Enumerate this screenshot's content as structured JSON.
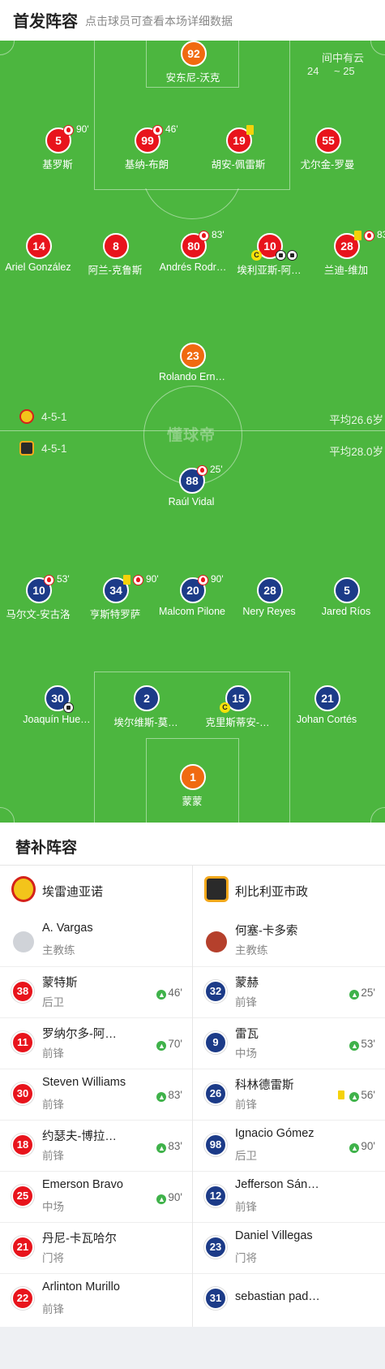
{
  "header": {
    "title": "首发阵容",
    "subtitle": "点击球员可查看本场详细数据"
  },
  "weather": {
    "condition": "间中有云",
    "temp_low": "24",
    "temp_high": "~ 25"
  },
  "watermark": "懂球帝",
  "home": {
    "formation": "4-5-1",
    "avg_age": "平均26.6岁",
    "players": [
      {
        "num": "92",
        "name": "安东尼-沃克",
        "color": "orange"
      },
      {
        "num": "5",
        "name": "基罗斯",
        "color": "red",
        "sub": "90'"
      },
      {
        "num": "99",
        "name": "基纳-布朗",
        "color": "red",
        "sub": "46'"
      },
      {
        "num": "19",
        "name": "胡安-佩雷斯",
        "color": "red"
      },
      {
        "num": "55",
        "name": "尤尔金-罗曼",
        "color": "red"
      },
      {
        "num": "14",
        "name": "Ariel González",
        "color": "red"
      },
      {
        "num": "8",
        "name": "阿兰-克鲁斯",
        "color": "red"
      },
      {
        "num": "80",
        "name": "Andrés Rodr…",
        "color": "red",
        "sub": "83'"
      },
      {
        "num": "10",
        "name": "埃利亚斯-阿…",
        "color": "red",
        "captain": "C"
      },
      {
        "num": "28",
        "name": "兰迪-维加",
        "color": "red",
        "sub": "83"
      },
      {
        "num": "23",
        "name": "Rolando Ern…",
        "color": "orange"
      }
    ]
  },
  "away": {
    "formation": "4-5-1",
    "avg_age": "平均28.0岁",
    "players": [
      {
        "num": "88",
        "name": "Raúl Vidal",
        "color": "blue",
        "sub": "25'"
      },
      {
        "num": "10",
        "name": "马尔文-安古洛",
        "color": "blue",
        "sub": "53'"
      },
      {
        "num": "34",
        "name": "亨斯特罗萨",
        "color": "blue",
        "sub": "90'"
      },
      {
        "num": "20",
        "name": "Malcom Pilone",
        "color": "blue",
        "sub": "90'"
      },
      {
        "num": "28",
        "name": "Nery Reyes",
        "color": "blue"
      },
      {
        "num": "5",
        "name": "Jared Ríos",
        "color": "blue"
      },
      {
        "num": "30",
        "name": "Joaquín Hue…",
        "color": "blue"
      },
      {
        "num": "2",
        "name": "埃尔维斯-莫…",
        "color": "blue"
      },
      {
        "num": "15",
        "name": "克里斯蒂安-…",
        "color": "blue",
        "captain": "C"
      },
      {
        "num": "21",
        "name": "Johan Cortés",
        "color": "blue"
      },
      {
        "num": "1",
        "name": "蒙蒙",
        "color": "orange"
      }
    ]
  },
  "bench": {
    "title": "替补阵容",
    "left": {
      "team": "埃雷迪亚诺",
      "coach": {
        "name": "A. Vargas",
        "role": "主教练"
      },
      "players": [
        {
          "num": "38",
          "name": "蒙特斯",
          "pos": "后卫",
          "sub": "46'"
        },
        {
          "num": "11",
          "name": "罗纳尔多-阿…",
          "pos": "前锋",
          "sub": "70'"
        },
        {
          "num": "30",
          "name": "Steven Williams",
          "pos": "前锋",
          "sub": "83'"
        },
        {
          "num": "18",
          "name": "约瑟夫-博拉…",
          "pos": "前锋",
          "sub": "83'"
        },
        {
          "num": "25",
          "name": "Emerson Bravo",
          "pos": "中场",
          "sub": "90'"
        },
        {
          "num": "21",
          "name": "丹尼-卡瓦哈尔",
          "pos": "门将",
          "sub": ""
        },
        {
          "num": "22",
          "name": "Arlinton Murillo",
          "pos": "前锋",
          "sub": ""
        }
      ]
    },
    "right": {
      "team": "利比利亚市政",
      "coach": {
        "name": "何塞-卡多索",
        "role": "主教练"
      },
      "players": [
        {
          "num": "32",
          "name": "蒙赫",
          "pos": "前锋",
          "sub": "25'"
        },
        {
          "num": "9",
          "name": "雷瓦",
          "pos": "中场",
          "sub": "53'"
        },
        {
          "num": "26",
          "name": "科林德雷斯",
          "pos": "前锋",
          "sub": "56'"
        },
        {
          "num": "98",
          "name": "Ignacio Gómez",
          "pos": "后卫",
          "sub": "90'"
        },
        {
          "num": "12",
          "name": "Jefferson Sán…",
          "pos": "前锋",
          "sub": ""
        },
        {
          "num": "23",
          "name": "Daniel Villegas",
          "pos": "门将",
          "sub": ""
        },
        {
          "num": "31",
          "name": "sebastian pad…",
          "pos": "",
          "sub": ""
        }
      ]
    }
  },
  "colors": {
    "pitch": "#4cb63f",
    "home": "#e8141c",
    "away": "#1c3b88",
    "keeper": "#f06a10",
    "sub_up": "#3fb24a"
  }
}
